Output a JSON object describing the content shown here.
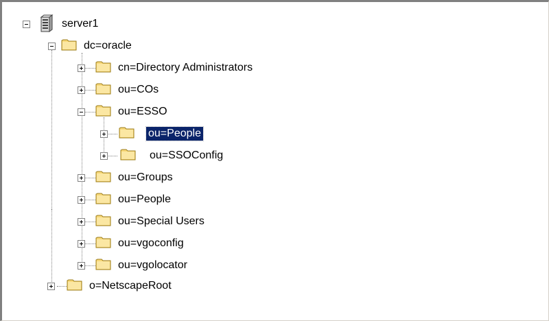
{
  "tree": {
    "root": {
      "label": "server1",
      "icon": "server-icon",
      "expanded": true
    },
    "dc": {
      "label": "dc=oracle",
      "icon": "folder-icon",
      "expanded": true
    },
    "dc_children": [
      {
        "label": "cn=Directory Administrators",
        "expanded": false
      },
      {
        "label": "ou=COs",
        "expanded": false
      },
      {
        "label": "ou=ESSO",
        "expanded": true
      },
      {
        "label": "ou=Groups",
        "expanded": false
      },
      {
        "label": "ou=People",
        "expanded": false
      },
      {
        "label": "ou=Special Users",
        "expanded": false
      },
      {
        "label": "ou=vgoconfig",
        "expanded": false
      },
      {
        "label": "ou=vgolocator",
        "expanded": false
      }
    ],
    "esso_children": [
      {
        "label": "ou=People",
        "expanded": false,
        "selected": true
      },
      {
        "label": "ou=SSOConfig",
        "expanded": false,
        "selected": false
      }
    ],
    "netscape": {
      "label": "o=NetscapeRoot",
      "expanded": false
    }
  },
  "colors": {
    "selection_bg": "#0a246a",
    "folder_fill": "#f8d97a",
    "folder_stroke": "#9b7c1a"
  }
}
